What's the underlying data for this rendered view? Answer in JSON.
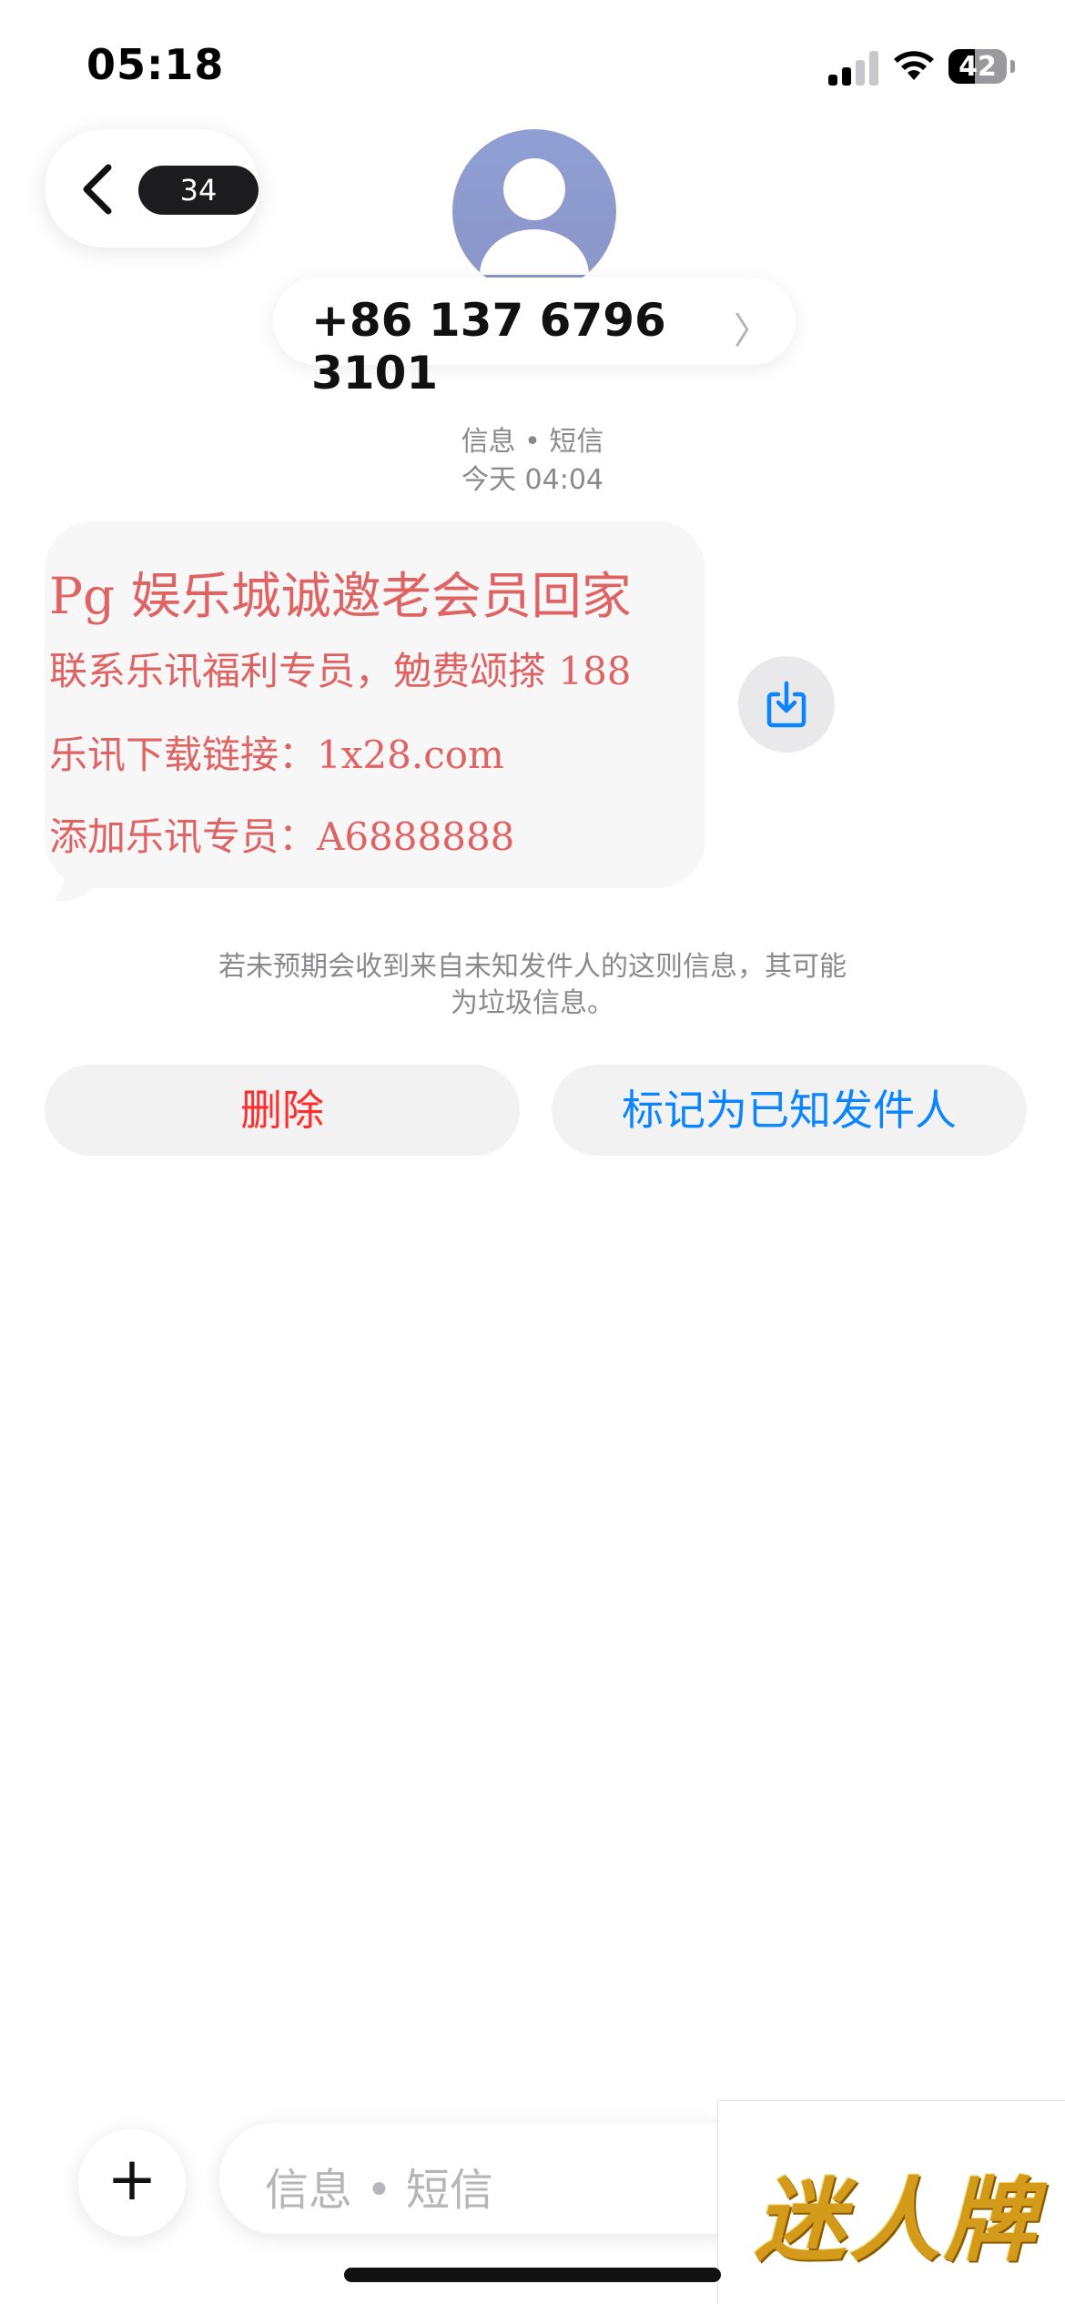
{
  "status_bar": {
    "time": "05:18",
    "battery": "42"
  },
  "header": {
    "back_count": "34",
    "phone_number": "+86 137 6796 3101",
    "chevron": "〉"
  },
  "meta": {
    "service": "信息 • 短信",
    "time": "今天 04:04"
  },
  "message": {
    "lines": [
      "Pg 娱乐城诚邀老会员回家",
      "联系乐讯福利专员，勉费颂搽 188",
      "乐讯下载链接：1x28.com",
      "添加乐讯专员：A6888888"
    ]
  },
  "warning": {
    "line1": "若未预期会收到来自未知发件人的这则信息，其可能",
    "line2": "为垃圾信息。"
  },
  "actions": {
    "delete_label": "删除",
    "mark_known_label": "标记为已知发件人"
  },
  "composer": {
    "placeholder": "信息 • 短信",
    "plus": "+"
  },
  "watermark": {
    "text": "迷人牌"
  },
  "icons": {
    "back": "chevron-left-icon",
    "avatar": "person-icon",
    "save": "save-download-icon",
    "add": "plus-icon"
  },
  "colors": {
    "delete": "#ff2d2d",
    "accent": "#0a84ff",
    "sms_text": "#e06363"
  }
}
